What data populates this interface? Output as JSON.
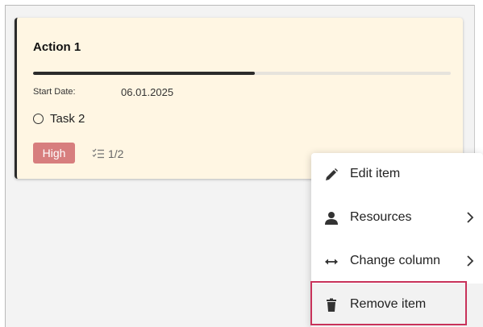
{
  "card": {
    "title": "Action 1",
    "progress": 0.53,
    "start_date_label": "Start Date:",
    "start_date_value": "06.01.2025",
    "task_label": "Task 2",
    "priority": "High",
    "checklist_count": "1/2",
    "colors": {
      "card_bg": "#fff6e3",
      "priority_bg": "#d77e7e",
      "highlight_border": "#c8325a"
    }
  },
  "menu": {
    "items": [
      {
        "label": "Edit item",
        "icon": "pencil-icon"
      },
      {
        "label": "Resources",
        "icon": "person-icon",
        "submenu": true
      },
      {
        "label": "Change column",
        "icon": "arrows-horizontal-icon",
        "submenu": true
      },
      {
        "label": "Remove item",
        "icon": "trash-icon",
        "highlighted": true
      }
    ]
  }
}
